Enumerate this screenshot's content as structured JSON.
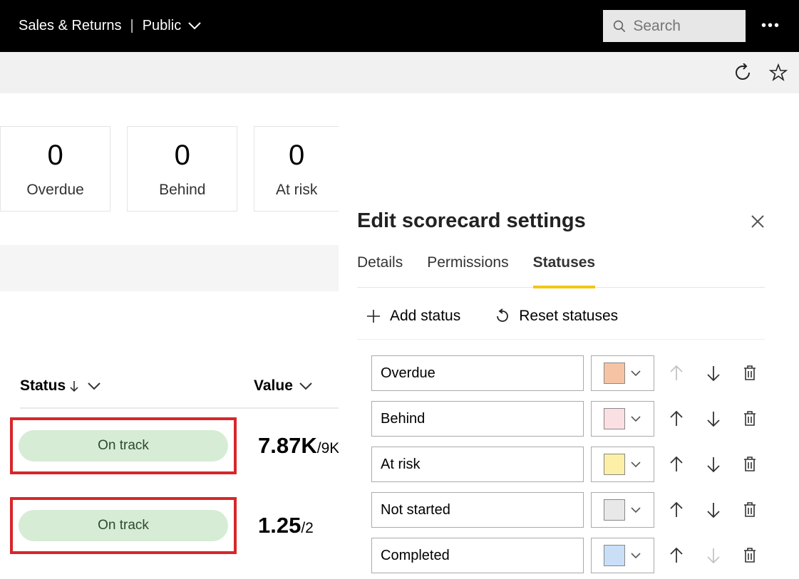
{
  "header": {
    "workspace": "Sales & Returns",
    "visibility": "Public",
    "searchPlaceholder": "Search"
  },
  "kpis": [
    {
      "value": "0",
      "label": "Overdue"
    },
    {
      "value": "0",
      "label": "Behind"
    },
    {
      "value": "0",
      "label": "At risk"
    }
  ],
  "table": {
    "statusHeader": "Status",
    "valueHeader": "Value",
    "rows": [
      {
        "status": "On track",
        "value": "7.87K",
        "denom": "/9K"
      },
      {
        "status": "On track",
        "value": "1.25",
        "denom": "/2"
      }
    ]
  },
  "panel": {
    "title": "Edit scorecard settings",
    "tabs": {
      "details": "Details",
      "permissions": "Permissions",
      "statuses": "Statuses"
    },
    "activeTab": "statuses",
    "actions": {
      "add": "Add status",
      "reset": "Reset statuses"
    },
    "statuses": [
      {
        "name": "Overdue",
        "color": "#f6c4a5",
        "upDisabled": true,
        "downDisabled": false
      },
      {
        "name": "Behind",
        "color": "#fbe0e3",
        "upDisabled": false,
        "downDisabled": false
      },
      {
        "name": "At risk",
        "color": "#fbf0a6",
        "upDisabled": false,
        "downDisabled": false
      },
      {
        "name": "Not started",
        "color": "#e8e8e8",
        "upDisabled": false,
        "downDisabled": false
      },
      {
        "name": "Completed",
        "color": "#c8dff7",
        "upDisabled": false,
        "downDisabled": true
      }
    ]
  }
}
